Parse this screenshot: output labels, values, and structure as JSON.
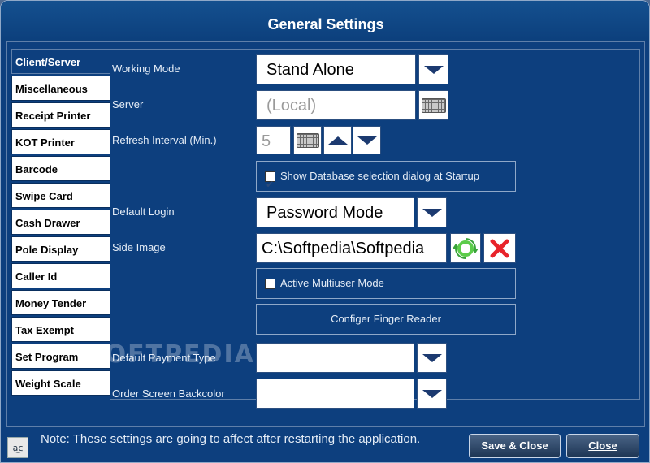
{
  "window": {
    "title": "General Settings"
  },
  "sidebar": {
    "tabs": [
      {
        "label": "Client/Server",
        "active": true
      },
      {
        "label": "Miscellaneous"
      },
      {
        "label": "Receipt Printer"
      },
      {
        "label": "KOT Printer"
      },
      {
        "label": "Barcode"
      },
      {
        "label": "Swipe Card"
      },
      {
        "label": "Cash Drawer"
      },
      {
        "label": "Pole Display"
      },
      {
        "label": "Caller Id"
      },
      {
        "label": "Money Tender"
      },
      {
        "label": "Tax Exempt"
      },
      {
        "label": "Set Program"
      },
      {
        "label": "Weight Scale"
      }
    ]
  },
  "form": {
    "working_mode": {
      "label": "Working Mode",
      "value": "Stand Alone"
    },
    "server": {
      "label": "Server",
      "value": "(Local)"
    },
    "refresh_interval": {
      "label": "Refresh Interval (Min.)",
      "value": "5"
    },
    "show_db_dialog": {
      "label": "Show Database selection dialog at Startup",
      "checked": true
    },
    "default_login": {
      "label": "Default Login",
      "value": "Password Mode"
    },
    "side_image": {
      "label": "Side Image",
      "value": "C:\\Softpedia\\Softpedia"
    },
    "active_multiuser": {
      "label": "Active Multiuser Mode",
      "checked": false
    },
    "finger_reader": {
      "label": "Configer Finger Reader"
    },
    "default_payment_type": {
      "label": "Default Payment Type",
      "value": ""
    },
    "order_screen_backcolor": {
      "label": "Order Screen Backcolor",
      "value": ""
    }
  },
  "footer": {
    "note": "Note: These settings are going to affect after restarting the application.",
    "save_close": "Save & Close",
    "close": "Close"
  },
  "watermark": "SOFTPEDIA®",
  "colors": {
    "background": "#0d3f7e",
    "border": "#8fa8c8",
    "text": "#e4ecf6"
  }
}
